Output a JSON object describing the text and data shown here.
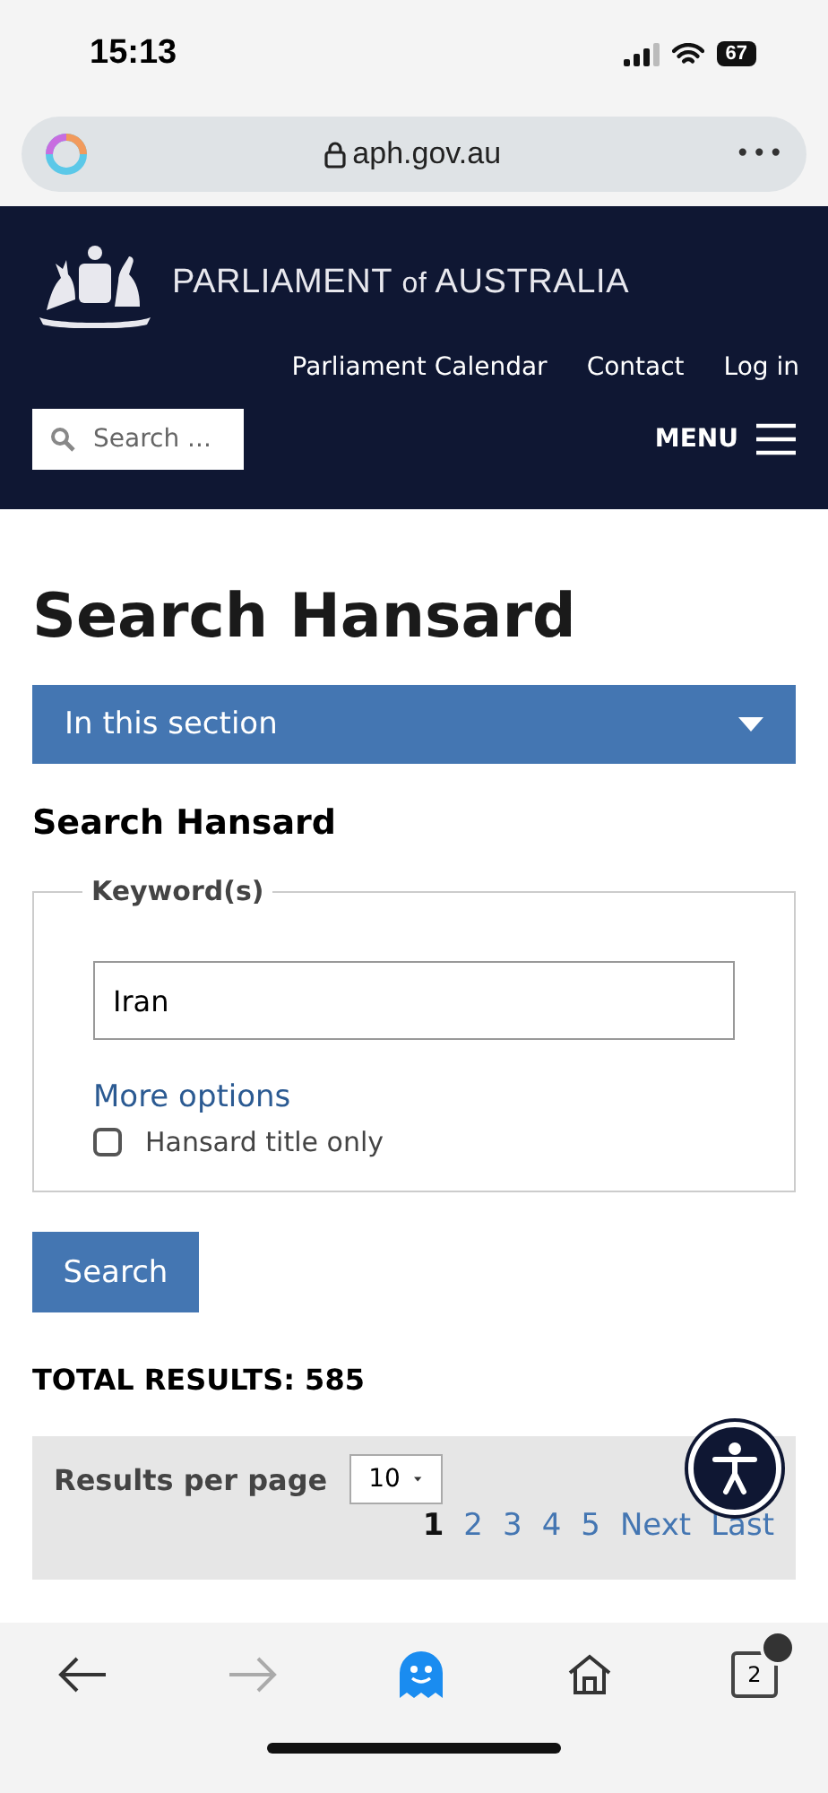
{
  "status_bar": {
    "time": "15:13",
    "battery": "67"
  },
  "browser": {
    "url": "aph.gov.au",
    "menu": "•••"
  },
  "header": {
    "brand_main": "PARLIAMENT",
    "brand_of": "of",
    "brand_end": "AUSTRALIA",
    "links": [
      "Parliament Calendar",
      "Contact",
      "Log in"
    ],
    "search": {
      "placeholder": "Search ..."
    },
    "menu": "MENU"
  },
  "page": {
    "title": "Search Hansard",
    "section_dropdown": "In this section",
    "subtitle": "Search Hansard",
    "form": {
      "legend": "Keyword(s)",
      "keyword": "Iran",
      "more_options": "More options",
      "checkbox": {
        "label": "Hansard title only",
        "checked": false
      }
    },
    "search_button": "Search",
    "total": "TOTAL RESULTS: 585",
    "results_per_page": {
      "label": "Results per page",
      "value": "10"
    },
    "pagination": [
      {
        "label": "1",
        "selected": true
      },
      {
        "label": "2",
        "selected": false
      },
      {
        "label": "3",
        "selected": false
      },
      {
        "label": "4",
        "selected": false
      },
      {
        "label": "5",
        "selected": false
      },
      {
        "label": "Next",
        "selected": false
      },
      {
        "label": "Last",
        "selected": false
      }
    ]
  },
  "toolbar": {
    "back_disabled": false,
    "forward_disabled": true,
    "tabs": "2"
  }
}
